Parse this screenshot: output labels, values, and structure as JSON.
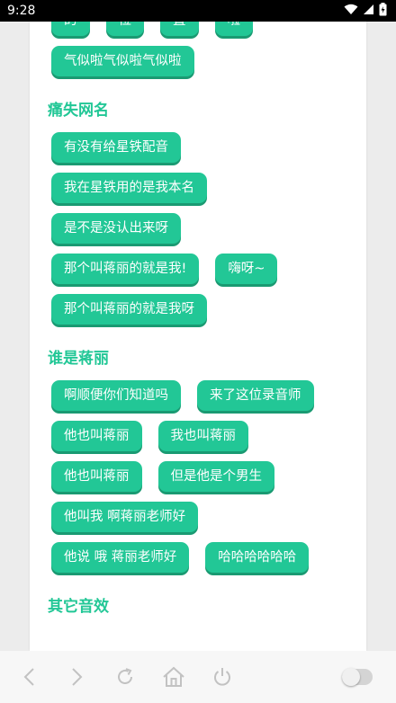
{
  "status_bar": {
    "time": "9:28",
    "icons": [
      "wifi-icon",
      "signal-icon",
      "battery-icon"
    ]
  },
  "colors": {
    "accent": "#22c796",
    "accent_shadow": "#1a9a72",
    "card_bg": "#ffffff",
    "page_bg": "#ececec"
  },
  "top_partial": {
    "buttons": [
      "的",
      "位",
      "置",
      "啦",
      "气似啦气似啦气似啦"
    ]
  },
  "sections": [
    {
      "title": "痛失网名",
      "buttons": [
        "有没有给星铁配音",
        "我在星铁用的是我本名",
        "是不是没认出来呀",
        "那个叫蒋丽的就是我!",
        "嗨呀~",
        "那个叫蒋丽的就是我呀"
      ]
    },
    {
      "title": "谁是蒋丽",
      "buttons": [
        "啊顺便你们知道吗",
        "来了这位录音师",
        "他也叫蒋丽",
        "我也叫蒋丽",
        "他也叫蒋丽",
        "但是他是个男生",
        "他叫我 啊蒋丽老师好",
        "他说 哦 蒋丽老师好",
        "哈哈哈哈哈哈"
      ]
    },
    {
      "title": "其它音效",
      "buttons": []
    }
  ],
  "bottom_bar": {
    "icons": [
      "back-icon",
      "forward-icon",
      "refresh-icon",
      "home-icon",
      "power-icon"
    ],
    "toggle_on": false
  }
}
